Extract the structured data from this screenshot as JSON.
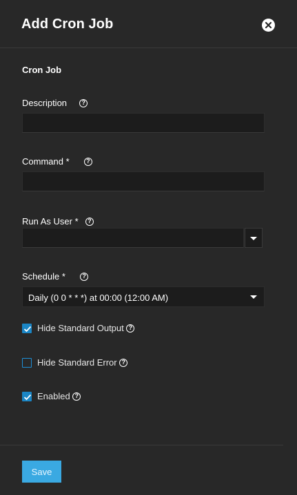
{
  "dialog": {
    "title": "Add Cron Job",
    "close_icon": "close-circle-icon"
  },
  "section": {
    "title": "Cron Job"
  },
  "fields": {
    "description": {
      "label": "Description",
      "value": "",
      "placeholder": ""
    },
    "command": {
      "label": "Command *",
      "value": "",
      "placeholder": ""
    },
    "run_as_user": {
      "label": "Run As User *",
      "value": "",
      "placeholder": ""
    },
    "schedule": {
      "label": "Schedule *",
      "value": "Daily (0 0 * * *) at 00:00 (12:00 AM)"
    }
  },
  "checkboxes": {
    "hide_stdout": {
      "label": "Hide Standard Output",
      "checked": true
    },
    "hide_stderr": {
      "label": "Hide Standard Error",
      "checked": false
    },
    "enabled": {
      "label": "Enabled",
      "checked": true
    }
  },
  "help_icon_glyph": "?",
  "footer": {
    "save_label": "Save"
  },
  "colors": {
    "panel_bg": "#282828",
    "input_bg": "#1c1c1c",
    "accent": "#1b86c5",
    "save_bg": "#3aa9e2"
  }
}
